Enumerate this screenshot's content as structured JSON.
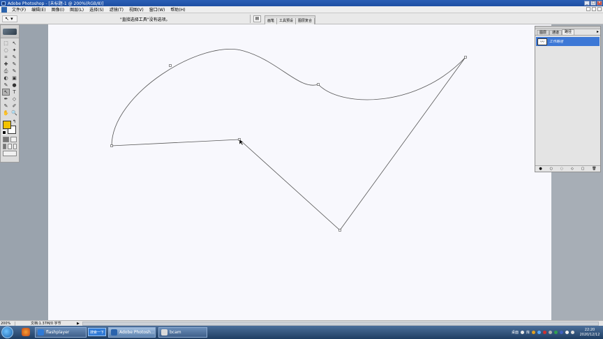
{
  "window": {
    "title": "Adobe Photoshop - [未标题-1 @ 200%(RGB/8)]",
    "controls": [
      "_",
      "□",
      "×"
    ]
  },
  "menu": {
    "items": [
      "文件(F)",
      "编辑(E)",
      "图像(I)",
      "图层(L)",
      "选择(S)",
      "滤镜(T)",
      "视图(V)",
      "窗口(W)",
      "帮助(H)"
    ]
  },
  "options": {
    "tool_glyph": "↖",
    "hint": "\"直接选择工具\"没有选项。",
    "palette_well_tabs": [
      "画笔",
      "工具预设",
      "图层复合"
    ]
  },
  "toolbox": {
    "tools": [
      "⬚",
      "↖",
      "◌",
      "✦",
      "⌗",
      "✎",
      "✚",
      "✎",
      "⎙",
      "✎",
      "◐",
      "▣",
      "✎",
      "●",
      "↖",
      "T",
      "✒",
      "◇",
      "✎",
      "✐",
      "✋",
      "🔍"
    ],
    "fg_color": "#f2c200",
    "bg_color": "#ffffff"
  },
  "palette": {
    "tabs": [
      "图层",
      "通道",
      "路径"
    ],
    "selected_tab": "路径",
    "menu_glyph": "▸",
    "path_name": "工作路径",
    "footer_icons": [
      "●",
      "○",
      "◌",
      "◇",
      "▢",
      "🗑"
    ]
  },
  "status": {
    "zoom": "200%",
    "doc_info": "文档:1.37M/0 字节",
    "arrow": "▶"
  },
  "taskbar": {
    "tasks": [
      {
        "label": "flashplayer",
        "active": false
      },
      {
        "label": "Adobe Photosh...",
        "active": true
      },
      {
        "label": "bcam",
        "active": false
      }
    ],
    "search_label": "搜索一下",
    "tray_text": "桌面",
    "tray_text2": "库",
    "clock_time": "22:20",
    "clock_date": "2020/12/12"
  },
  "colors": {
    "title_blue": "#1d4fa3",
    "canvas": "#f8f8fd",
    "workspace": "#9aa3ad",
    "palette_select": "#3d78d6",
    "path_stroke": "#555555"
  }
}
